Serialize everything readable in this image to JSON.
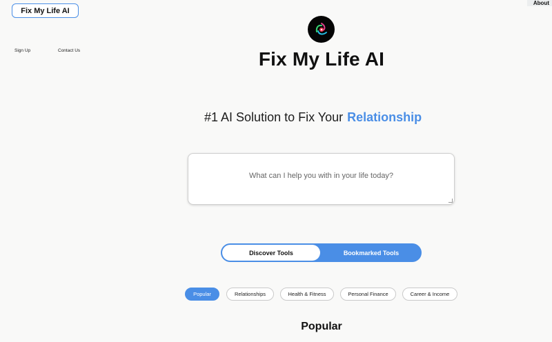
{
  "header": {
    "brand": "Fix My Life AI",
    "about": "About",
    "nav": {
      "signup": "Sign Up",
      "contact": "Contact Us"
    }
  },
  "hero": {
    "title": "Fix My Life AI",
    "subtitle_prefix": "#1 AI Solution to Fix Your",
    "subtitle_highlight": "Relationship",
    "prompt_placeholder": "What can I help you with in your life today?"
  },
  "tools_toggle": {
    "discover": "Discover Tools",
    "bookmarked": "Bookmarked Tools",
    "active": "discover"
  },
  "categories": [
    {
      "label": "Popular",
      "active": true
    },
    {
      "label": "Relationships",
      "active": false
    },
    {
      "label": "Health & Fitness",
      "active": false
    },
    {
      "label": "Personal Finance",
      "active": false
    },
    {
      "label": "Career & Income",
      "active": false
    }
  ],
  "section": {
    "title": "Popular"
  },
  "colors": {
    "accent": "#4a8ee6",
    "background": "#f9f9f8"
  }
}
